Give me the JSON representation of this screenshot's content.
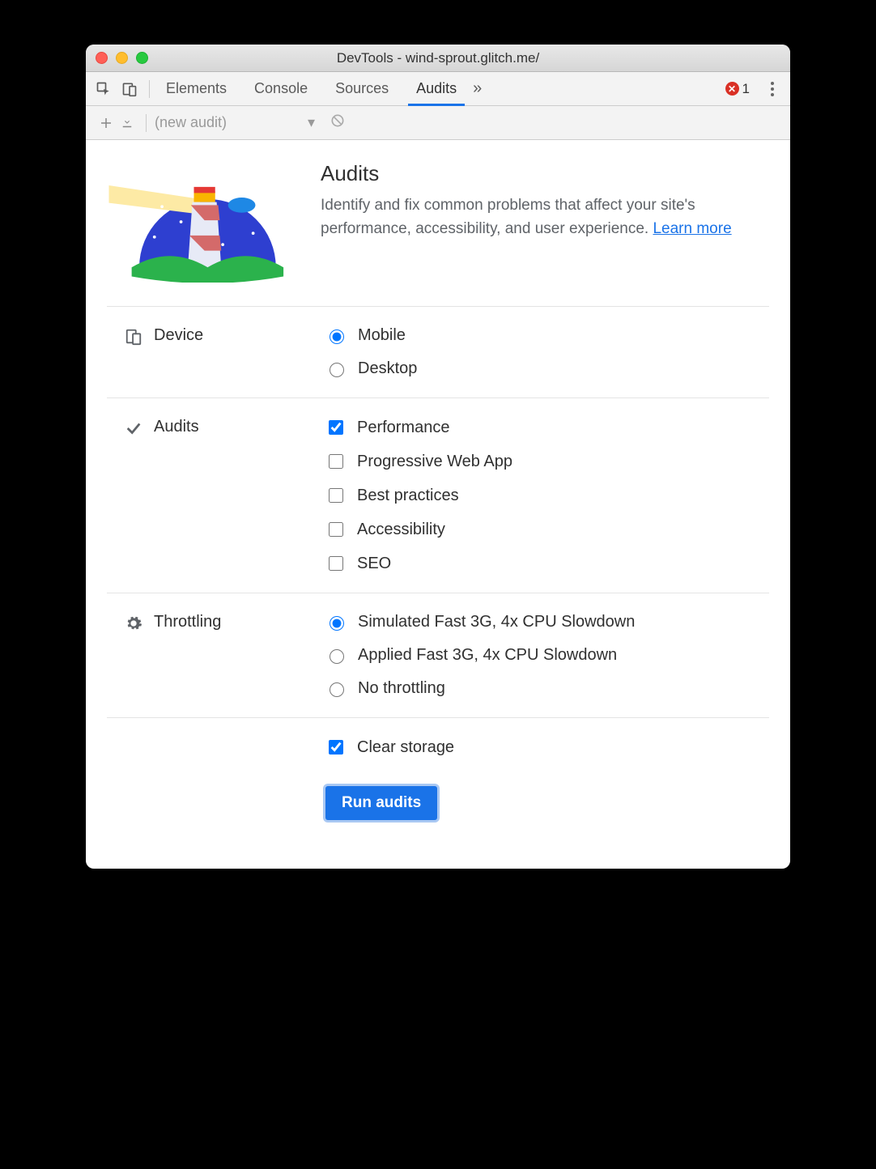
{
  "window_title": "DevTools - wind-sprout.glitch.me/",
  "tabs": {
    "items": [
      "Elements",
      "Console",
      "Sources",
      "Audits"
    ],
    "active_index": 3
  },
  "error_count": "1",
  "subbar": {
    "selected": "(new audit)"
  },
  "intro": {
    "heading": "Audits",
    "body": "Identify and fix common problems that affect your site's performance, accessibility, and user experience. ",
    "learn_more": "Learn more"
  },
  "sections": {
    "device": {
      "label": "Device",
      "options": [
        {
          "label": "Mobile",
          "checked": true
        },
        {
          "label": "Desktop",
          "checked": false
        }
      ]
    },
    "audits": {
      "label": "Audits",
      "options": [
        {
          "label": "Performance",
          "checked": true
        },
        {
          "label": "Progressive Web App",
          "checked": false
        },
        {
          "label": "Best practices",
          "checked": false
        },
        {
          "label": "Accessibility",
          "checked": false
        },
        {
          "label": "SEO",
          "checked": false
        }
      ]
    },
    "throttling": {
      "label": "Throttling",
      "options": [
        {
          "label": "Simulated Fast 3G, 4x CPU Slowdown",
          "checked": true
        },
        {
          "label": "Applied Fast 3G, 4x CPU Slowdown",
          "checked": false
        },
        {
          "label": "No throttling",
          "checked": false
        }
      ]
    },
    "clear_storage": {
      "label": "Clear storage",
      "checked": true
    }
  },
  "run_button": "Run audits"
}
